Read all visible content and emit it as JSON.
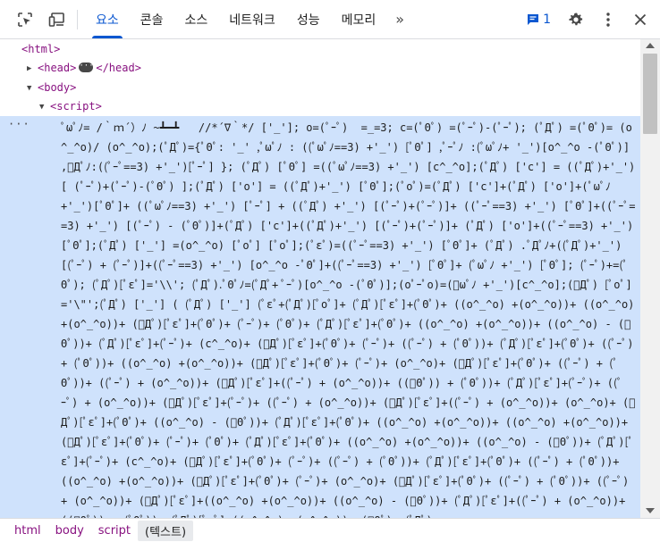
{
  "toolbar": {
    "tabs": [
      {
        "label": "요소",
        "active": true
      },
      {
        "label": "콘솔",
        "active": false
      },
      {
        "label": "소스",
        "active": false
      },
      {
        "label": "네트워크",
        "active": false
      },
      {
        "label": "성능",
        "active": false
      },
      {
        "label": "메모리",
        "active": false
      }
    ],
    "more_tabs": "»",
    "issues_count": "1",
    "icons": [
      "inspect-element-icon",
      "device-toolbar-icon",
      "chevron-double-right-icon",
      "issues-chat-icon",
      "settings-gear-icon",
      "kebab-menu-icon",
      "close-icon"
    ],
    "accent_color": "#0b57d0"
  },
  "tree": {
    "html_open": "<html>",
    "head_open": "<head>",
    "head_close": "</head>",
    "body_open": "<body>",
    "script_open": "<script>",
    "gutter": "···",
    "script_text": "ﾟωﾟﾉ= /｀ｍ´）ﾉ ~┻━┻   //*´∇｀*/ ['_']; o=(ﾟｰﾟ)  =_=3; c=(ﾟΘﾟ) =(ﾟｰﾟ)-(ﾟｰﾟ); (ﾟДﾟ) =(ﾟΘﾟ)= (o^_^o)/ (o^_^o);(ﾟДﾟ)={ﾟΘﾟ: '_' ,ﾟωﾟﾉ : ((ﾟωﾟﾉ==3) +'_') [ﾟΘﾟ] ,ﾟｰﾟﾉ :(ﾟωﾟﾉ+ '_')[o^_^o -(ﾟΘﾟ)] ,ﾟДﾟﾉ:((ﾟｰﾟ==3) +'_')[ﾟｰﾟ] }; (ﾟДﾟ) [ﾟΘﾟ] =((ﾟωﾟﾉ==3) +'_') [c^_^o];(ﾟДﾟ) ['c'] = ((ﾟДﾟ)+'_') [ (ﾟｰﾟ)+(ﾟｰﾟ)-(ﾟΘﾟ) ];(ﾟДﾟ) ['o'] = ((ﾟДﾟ)+'_') [ﾟΘﾟ];(ﾟoﾟ)=(ﾟДﾟ) ['c']+(ﾟДﾟ) ['o']+(ﾟωﾟﾉ +'_')[ﾟΘﾟ]+ ((ﾟωﾟﾉ==3) +'_') [ﾟｰﾟ] + ((ﾟДﾟ) +'_') [(ﾟｰﾟ)+(ﾟｰﾟ)]+ ((ﾟｰﾟ==3) +'_') [ﾟΘﾟ]+((ﾟｰﾟ==3) +'_') [(ﾟｰﾟ) - (ﾟΘﾟ)]+(ﾟДﾟ) ['c']+((ﾟДﾟ)+'_') [(ﾟｰﾟ)+(ﾟｰﾟ)]+ (ﾟДﾟ) ['o']+((ﾟｰﾟ==3) +'_') [ﾟΘﾟ];(ﾟДﾟ) ['_'] =(o^_^o) [ﾟoﾟ] [ﾟoﾟ];(ﾟεﾟ)=((ﾟｰﾟ==3) +'_') [ﾟΘﾟ]+ (ﾟДﾟ) .ﾟДﾟﾉ+((ﾟДﾟ)+'_') [(ﾟｰﾟ) + (ﾟｰﾟ)]+((ﾟｰﾟ==3) +'_') [o^_^o -ﾟΘﾟ]+((ﾟｰﾟ==3) +'_') [ﾟΘﾟ]+ (ﾟωﾟﾉ +'_') [ﾟΘﾟ]; (ﾟｰﾟ)+=(ﾟΘﾟ); (ﾟДﾟ)[ﾟεﾟ]='\\\\'; (ﾟДﾟ).ﾟΘﾟﾉ=(ﾟДﾟ+ ﾟｰﾟ)[o^_^o -(ﾟΘﾟ)];(oﾟｰﾟo)=(ﾟωﾟﾉ +'_')[c^_^o];(ﾟДﾟ) [ﾟoﾟ]='\\\"';(ﾟДﾟ) ['_'] ( (ﾟДﾟ) ['_'] (ﾟεﾟ+(ﾟДﾟ)[ﾟoﾟ]+ (ﾟДﾟ)[ﾟεﾟ]+(ﾟΘﾟ)+ ((o^_^o) +(o^_^o))+ ((o^_^o) +(o^_^o))+ (ﾟДﾟ)[ﾟεﾟ]+(ﾟΘﾟ)+ (ﾟｰﾟ)+ (ﾟΘﾟ)+ (ﾟДﾟ)[ﾟεﾟ]+(ﾟΘﾟ)+ ((o^_^o) +(o^_^o))+ ((o^_^o) - (ﾟΘﾟ))+ (ﾟДﾟ)[ﾟεﾟ]+(ﾟｰﾟ)+ (c^_^o)+ (ﾟДﾟ)[ﾟεﾟ]+(ﾟΘﾟ)+ (ﾟｰﾟ)+ ((ﾟｰﾟ) + (ﾟΘﾟ))+ (ﾟДﾟ)[ﾟεﾟ]+(ﾟΘﾟ)+ ((ﾟｰﾟ) + (ﾟΘﾟ))+ ((o^_^o) +(o^_^o))+ (ﾟДﾟ)[ﾟεﾟ]+(ﾟΘﾟ)+ (ﾟｰﾟ)+ (o^_^o)+ (ﾟДﾟ)[ﾟεﾟ]+(ﾟΘﾟ)+ ((ﾟｰﾟ) + (ﾟΘﾟ))+ ((ﾟｰﾟ) + (o^_^o))+ (ﾟДﾟ)[ﾟεﾟ]+((ﾟｰﾟ) + (o^_^o))+ ((ﾟΘﾟ)) + (ﾟΘﾟ))+ (ﾟДﾟ)[ﾟεﾟ]+(ﾟｰﾟ)+ ((ﾟｰﾟ) + (o^_^o))+ (ﾟДﾟ)[ﾟεﾟ]+(ﾟｰﾟ)+ ((ﾟｰﾟ) + (o^_^o))+ (ﾟДﾟ)[ﾟεﾟ]+((ﾟｰﾟ) + (o^_^o))+ (o^_^o)+ (ﾟДﾟ)[ﾟεﾟ]+(ﾟΘﾟ)+ ((o^_^o) - (ﾟΘﾟ))+ (ﾟДﾟ)[ﾟεﾟ]+(ﾟΘﾟ)+ ((o^_^o) +(o^_^o))+ ((o^_^o) +(o^_^o))+ (ﾟДﾟ)[ﾟεﾟ]+(ﾟΘﾟ)+ (ﾟｰﾟ)+ (ﾟΘﾟ)+ (ﾟДﾟ)[ﾟεﾟ]+(ﾟΘﾟ)+ ((o^_^o) +(o^_^o))+ ((o^_^o) - (ﾟΘﾟ))+ (ﾟДﾟ)[ﾟεﾟ]+(ﾟｰﾟ)+ (c^_^o)+ (ﾟДﾟ)[ﾟεﾟ]+(ﾟΘﾟ)+ (ﾟｰﾟ)+ ((ﾟｰﾟ) + (ﾟΘﾟ))+ (ﾟДﾟ)[ﾟεﾟ]+(ﾟΘﾟ)+ ((ﾟｰﾟ) + (ﾟΘﾟ))+ ((o^_^o) +(o^_^o))+ (ﾟДﾟ)[ﾟεﾟ]+(ﾟΘﾟ)+ (ﾟｰﾟ)+ (o^_^o)+ (ﾟДﾟ)[ﾟεﾟ]+(ﾟΘﾟ)+ ((ﾟｰﾟ) + (ﾟΘﾟ))+ ((ﾟｰﾟ) + (o^_^o))+ (ﾟДﾟ)[ﾟεﾟ]+((o^_^o) +(o^_^o))+ ((o^_^o) - (ﾟΘﾟ))+ (ﾟДﾟ)[ﾟεﾟ]+((ﾟｰﾟ) + (o^_^o))+ ((ﾟΘﾟ)) + (ﾟΘﾟ))+ (ﾟДﾟ)[ﾟεﾟ]+((o^_^o) +(o^_^o))+ (ﾟΘﾟ)+ (ﾟДﾟ)"
  },
  "breadcrumbs": [
    "html",
    "body",
    "script",
    "(텍스트)"
  ]
}
